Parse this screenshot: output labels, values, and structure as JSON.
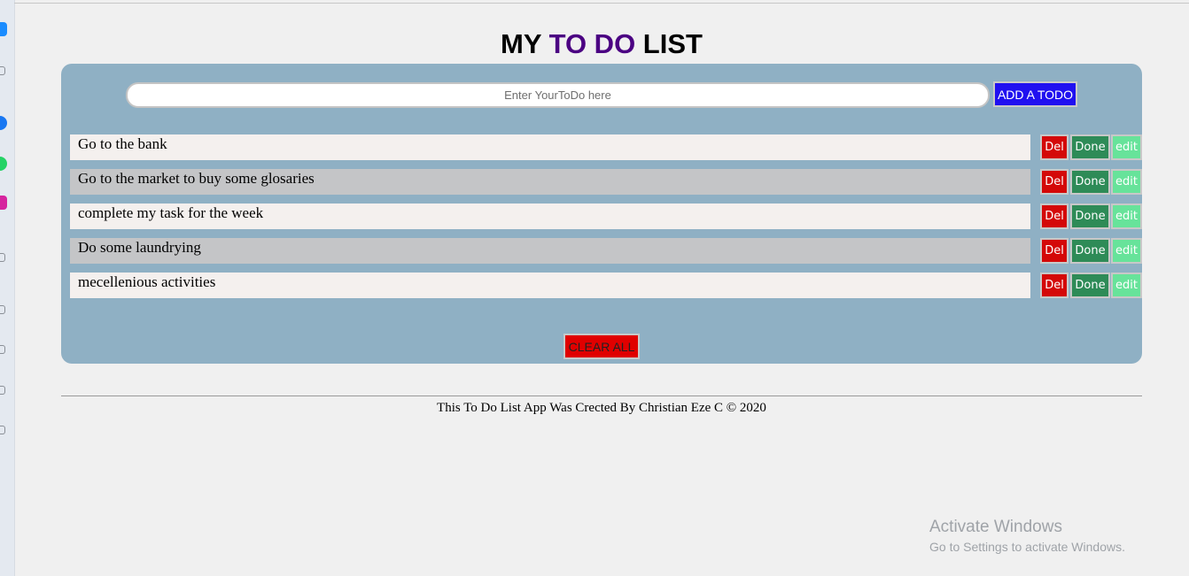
{
  "header": {
    "title_part1": "MY ",
    "title_accent": "TO DO",
    "title_part2": " LIST",
    "accent_color": "#4b0082"
  },
  "form": {
    "input_placeholder": "Enter YourToDo here",
    "input_value": "",
    "add_button_label": "ADD A TODO"
  },
  "todos": [
    {
      "text": "Go to the bank",
      "del_label": "Del",
      "done_label": "Done",
      "edit_label": "edit"
    },
    {
      "text": "Go to the market to buy some glosaries",
      "del_label": "Del",
      "done_label": "Done",
      "edit_label": "edit"
    },
    {
      "text": "complete my task for the week",
      "del_label": "Del",
      "done_label": "Done",
      "edit_label": "edit"
    },
    {
      "text": "Do some laundrying",
      "del_label": "Del",
      "done_label": "Done",
      "edit_label": "edit"
    },
    {
      "text": "mecellenious activities",
      "del_label": "Del",
      "done_label": "Done",
      "edit_label": "edit"
    }
  ],
  "clear_all_label": "CLEAR ALL",
  "footer": {
    "text": "This To Do List App Was Crected By Christian Eze C © 2020"
  },
  "watermark": {
    "title": "Activate Windows",
    "subtitle": "Go to Settings to activate Windows."
  },
  "colors": {
    "panel": "#8fb0c4",
    "add_button": "#2010f0",
    "del_button": "#d40808",
    "done_button": "#2e8b57",
    "edit_button": "#67e39a",
    "clear_button": "#e00000"
  },
  "taskbar_icons": [
    "app-icon",
    "bookmark-icon",
    "messenger-icon",
    "whatsapp-icon",
    "instagram-icon",
    "play-icon",
    "grid-icon",
    "chat-icon",
    "page-icon",
    "clock-icon"
  ]
}
